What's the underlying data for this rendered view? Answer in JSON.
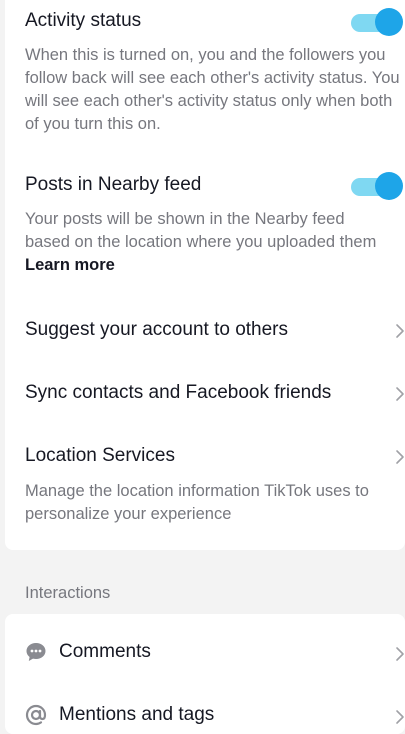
{
  "privacy": {
    "activity_status": {
      "title": "Activity status",
      "description": "When this is turned on, you and the followers you follow back will see each other's activity status. You will see each other's activity status only when both of you turn this on.",
      "enabled": true
    },
    "nearby_feed": {
      "title": "Posts in Nearby feed",
      "description": "Your posts will be shown in the Nearby feed based on the location where you uploaded them",
      "learn_more": "Learn more",
      "enabled": true
    },
    "suggest_account": {
      "title": "Suggest your account to others"
    },
    "sync_contacts": {
      "title": "Sync contacts and Facebook friends"
    },
    "location_services": {
      "title": "Location Services",
      "description": "Manage the location information TikTok uses to personalize your experience"
    }
  },
  "interactions": {
    "section_label": "Interactions",
    "items": [
      {
        "label": "Comments",
        "icon": "comment-bubble-icon"
      },
      {
        "label": "Mentions and tags",
        "icon": "at-sign-icon"
      }
    ]
  },
  "colors": {
    "toggle_on_track": "#7fd8f2",
    "toggle_on_knob": "#1ea5e8",
    "secondary_text": "#76777e",
    "primary_text": "#161823",
    "background": "#f3f3f3"
  }
}
